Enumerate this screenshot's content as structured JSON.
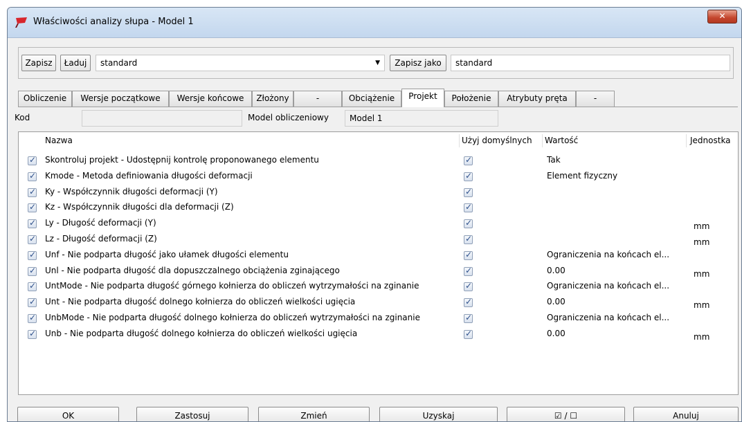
{
  "window": {
    "title": "Właściwości analizy słupa - Model 1",
    "close_label": "✕"
  },
  "toolbar": {
    "save_label": "Zapisz",
    "load_label": "Ładuj",
    "preset_value": "standard",
    "save_as_label": "Zapisz jako",
    "save_as_value": "standard"
  },
  "tabs": [
    {
      "label": "Obliczenie"
    },
    {
      "label": "Wersje początkowe"
    },
    {
      "label": "Wersje końcowe"
    },
    {
      "label": "Złożony"
    },
    {
      "label": "-"
    },
    {
      "label": "Obciążenie"
    },
    {
      "label": "Projekt",
      "active": true
    },
    {
      "label": "Położenie"
    },
    {
      "label": "Atrybuty pręta"
    },
    {
      "label": "-"
    }
  ],
  "form": {
    "code_label": "Kod",
    "code_value": "",
    "model_label": "Model obliczeniowy",
    "model_value": "Model 1"
  },
  "grid": {
    "headers": {
      "name": "Nazwa",
      "use_default": "Użyj domyślnych",
      "value": "Wartość",
      "unit": "Jednostka"
    },
    "rows": [
      {
        "checked": true,
        "name": "Skontroluj projekt - Udostępnij kontrolę proponowanego elementu",
        "use_default": true,
        "value": "Tak",
        "unit": ""
      },
      {
        "checked": true,
        "name": "Kmode - Metoda definiowania długości deformacji",
        "use_default": true,
        "value": "Element fizyczny",
        "unit": ""
      },
      {
        "checked": true,
        "name": "Ky - Współczynnik długości deformacji (Y)",
        "use_default": true,
        "value": "",
        "unit": ""
      },
      {
        "checked": true,
        "name": "Kz - Współczynnik długości dla deformacji (Z)",
        "use_default": true,
        "value": "",
        "unit": ""
      },
      {
        "checked": true,
        "name": "Ly - Długość deformacji (Y)",
        "use_default": true,
        "value": "",
        "unit": "mm"
      },
      {
        "checked": true,
        "name": "Lz - Długość deformacji (Z)",
        "use_default": true,
        "value": "",
        "unit": "mm"
      },
      {
        "checked": true,
        "name": "Unf - Nie podparta długość jako ułamek długości elementu",
        "use_default": true,
        "value": "Ograniczenia na końcach el...",
        "unit": ""
      },
      {
        "checked": true,
        "name": "Unl - Nie podparta długość dla dopuszczalnego obciążenia zginającego",
        "use_default": true,
        "value": "0.00",
        "unit": "mm"
      },
      {
        "checked": true,
        "name": "UntMode - Nie podparta długość górnego kołnierza do obliczeń wytrzymałości na zginanie",
        "use_default": true,
        "value": "Ograniczenia na końcach el...",
        "unit": ""
      },
      {
        "checked": true,
        "name": "Unt - Nie podparta długość dolnego kołnierza do obliczeń wielkości ugięcia",
        "use_default": true,
        "value": "0.00",
        "unit": "mm"
      },
      {
        "checked": true,
        "name": "UnbMode - Nie podparta długość dolnego kołnierza do obliczeń wytrzymałości na zginanie",
        "use_default": true,
        "value": "Ograniczenia na końcach el...",
        "unit": ""
      },
      {
        "checked": true,
        "name": "Unb - Nie podparta długość dolnego kołnierza do obliczeń wielkości ugięcia",
        "use_default": true,
        "value": "0.00",
        "unit": "mm"
      }
    ]
  },
  "buttons": {
    "ok": "OK",
    "apply": "Zastosuj",
    "modify": "Zmień",
    "get": "Uzyskaj",
    "toggle": "☑ / ☐",
    "cancel": "Anuluj"
  },
  "colors": {
    "titlebar": "#c9dcf1",
    "close": "#c4452c",
    "checkmark": "#2c4f8a"
  }
}
